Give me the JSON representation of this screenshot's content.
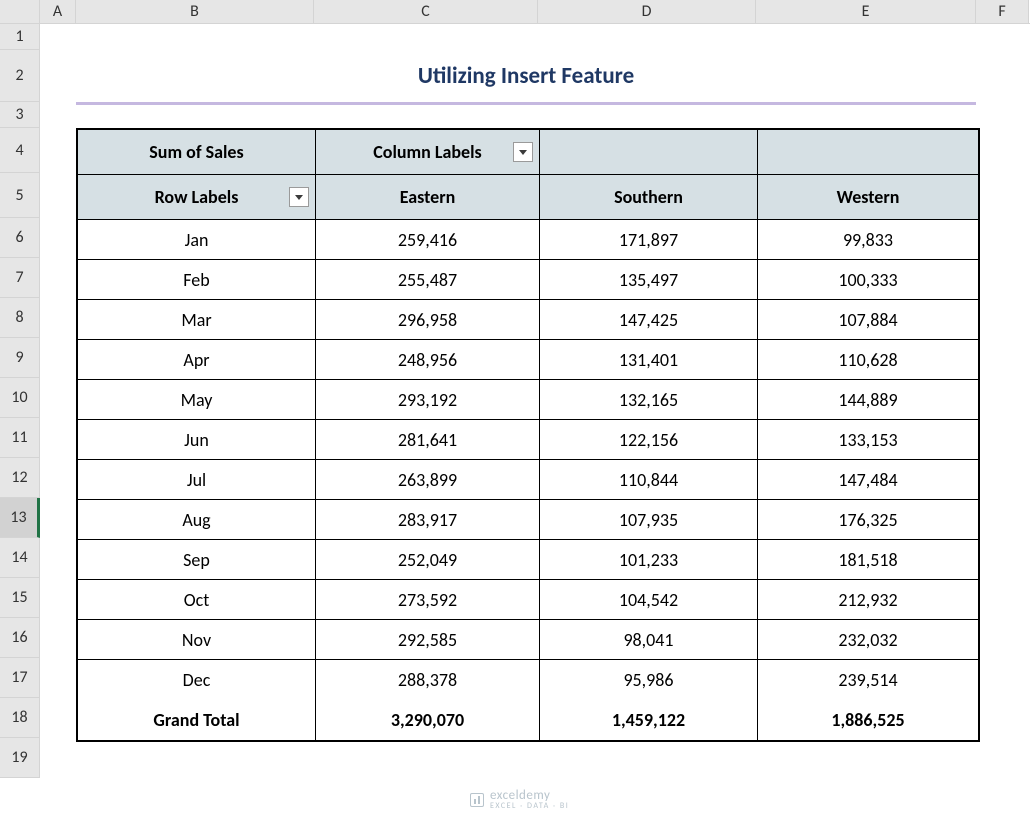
{
  "columns": [
    "A",
    "B",
    "C",
    "D",
    "E",
    "F"
  ],
  "row_nums": [
    "1",
    "2",
    "3",
    "4",
    "5",
    "6",
    "7",
    "8",
    "9",
    "10",
    "11",
    "12",
    "13",
    "14",
    "15",
    "16",
    "17",
    "18",
    "19"
  ],
  "selected_row": "13",
  "title": "Utilizing Insert Feature",
  "pivot": {
    "sum_label": "Sum of Sales",
    "col_labels_label": "Column Labels",
    "row_labels_label": "Row Labels",
    "col_headers": [
      "Eastern",
      "Southern",
      "Western"
    ],
    "rows": [
      {
        "label": "Jan",
        "vals": [
          "259,416",
          "171,897",
          "99,833"
        ]
      },
      {
        "label": "Feb",
        "vals": [
          "255,487",
          "135,497",
          "100,333"
        ]
      },
      {
        "label": "Mar",
        "vals": [
          "296,958",
          "147,425",
          "107,884"
        ]
      },
      {
        "label": "Apr",
        "vals": [
          "248,956",
          "131,401",
          "110,628"
        ]
      },
      {
        "label": "May",
        "vals": [
          "293,192",
          "132,165",
          "144,889"
        ]
      },
      {
        "label": "Jun",
        "vals": [
          "281,641",
          "122,156",
          "133,153"
        ]
      },
      {
        "label": "Jul",
        "vals": [
          "263,899",
          "110,844",
          "147,484"
        ]
      },
      {
        "label": "Aug",
        "vals": [
          "283,917",
          "107,935",
          "176,325"
        ]
      },
      {
        "label": "Sep",
        "vals": [
          "252,049",
          "101,233",
          "181,518"
        ]
      },
      {
        "label": "Oct",
        "vals": [
          "273,592",
          "104,542",
          "212,932"
        ]
      },
      {
        "label": "Nov",
        "vals": [
          "292,585",
          "98,041",
          "232,032"
        ]
      },
      {
        "label": "Dec",
        "vals": [
          "288,378",
          "95,986",
          "239,514"
        ]
      }
    ],
    "total_label": "Grand Total",
    "totals": [
      "3,290,070",
      "1,459,122",
      "1,886,525"
    ]
  },
  "watermark": {
    "brand": "exceldemy",
    "tagline": "EXCEL · DATA · BI"
  }
}
